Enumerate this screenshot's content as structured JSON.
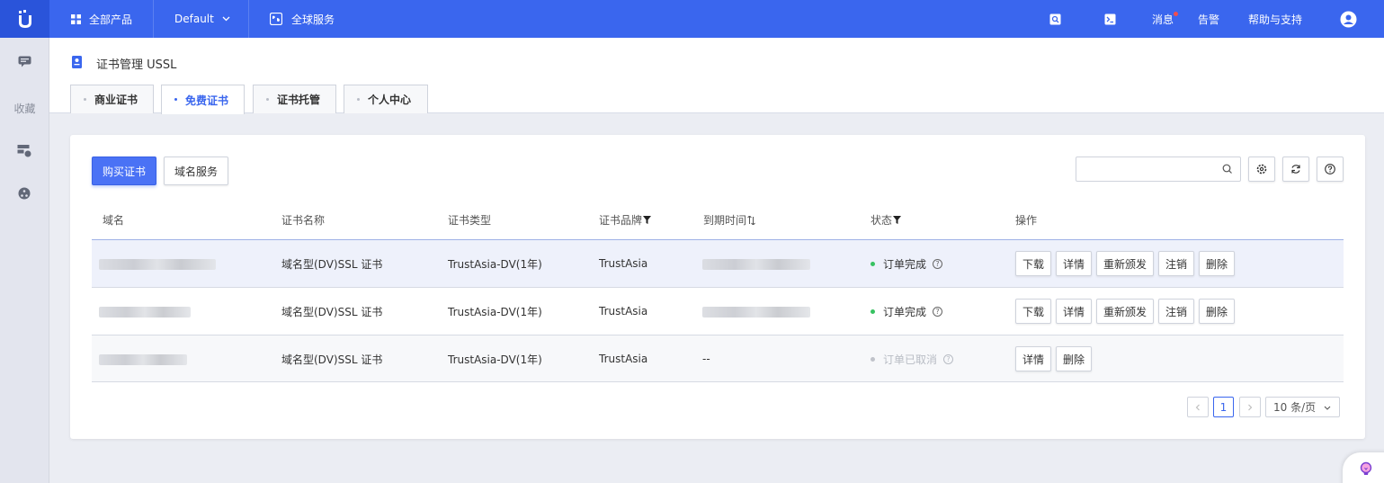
{
  "topbar": {
    "all_products": "全部产品",
    "project": "Default",
    "global_service": "全球服务",
    "messages": "消息",
    "alerts": "告警",
    "help": "帮助与支持"
  },
  "sidebar": {
    "favorites": "收藏"
  },
  "header": {
    "title": "证书管理 USSL",
    "tabs": [
      {
        "label": "商业证书"
      },
      {
        "label": "免费证书"
      },
      {
        "label": "证书托管"
      },
      {
        "label": "个人中心"
      }
    ]
  },
  "toolbar": {
    "buy_label": "购买证书",
    "domain_service_label": "域名服务",
    "search_placeholder": ""
  },
  "table": {
    "headers": {
      "domain": "域名",
      "cert_name": "证书名称",
      "cert_type": "证书类型",
      "brand": "证书品牌",
      "expire": "到期时间",
      "status": "状态",
      "actions": "操作"
    },
    "rows": [
      {
        "cert_name": "域名型(DV)SSL 证书",
        "cert_type": "TrustAsia-DV(1年)",
        "brand": "TrustAsia",
        "expire": "",
        "status": "订单完成",
        "actions": [
          "下载",
          "详情",
          "重新颁发",
          "注销",
          "删除"
        ]
      },
      {
        "cert_name": "域名型(DV)SSL 证书",
        "cert_type": "TrustAsia-DV(1年)",
        "brand": "TrustAsia",
        "expire": "",
        "status": "订单完成",
        "actions": [
          "下载",
          "详情",
          "重新颁发",
          "注销",
          "删除"
        ]
      },
      {
        "cert_name": "域名型(DV)SSL 证书",
        "cert_type": "TrustAsia-DV(1年)",
        "brand": "TrustAsia",
        "expire": "--",
        "status": "订单已取消",
        "actions": [
          "详情",
          "删除"
        ]
      }
    ]
  },
  "pagination": {
    "current_page": "1",
    "page_size": "10 条/页"
  },
  "colors": {
    "brand_blue": "#3a66ee",
    "status_done": "#37c261",
    "status_cancelled": "#c0c3ca"
  }
}
